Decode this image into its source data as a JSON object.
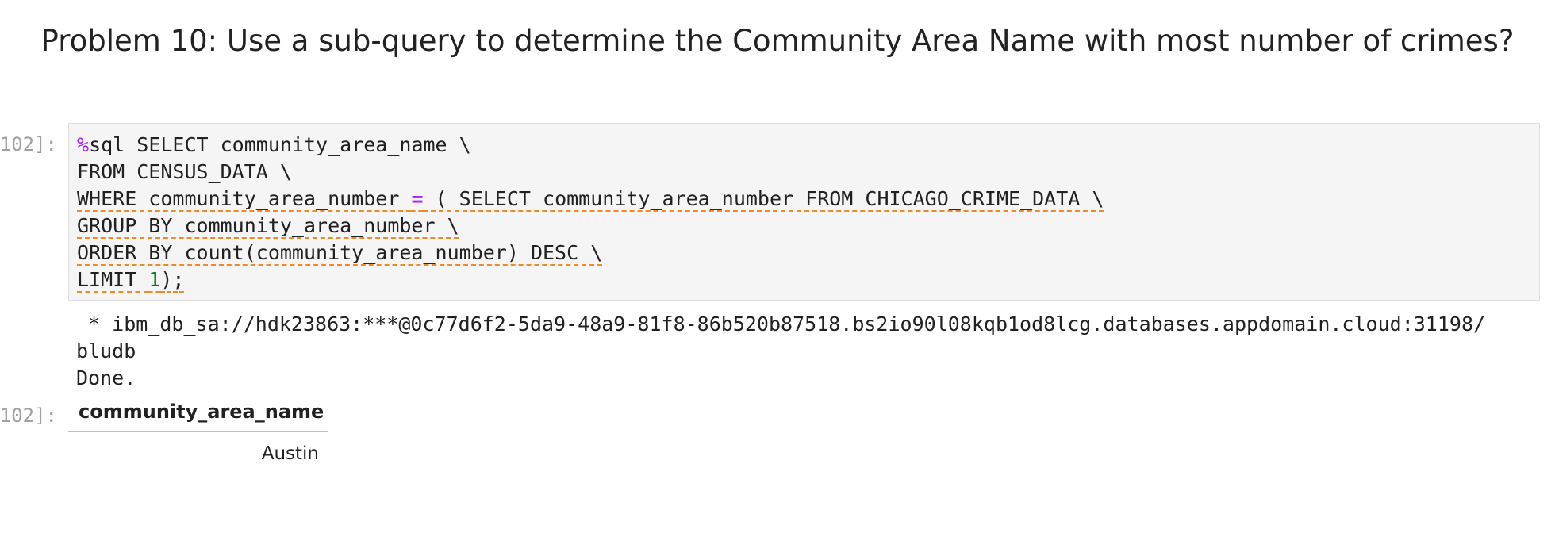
{
  "heading": "Problem 10: Use a sub-query to determine the Community Area Name with most number of crimes?",
  "input_prompt": "102]:",
  "output_prompt": "102]:",
  "code": {
    "magic": "%",
    "line1_rest": "sql SELECT community_area_name \\",
    "line2": "FROM CENSUS_DATA \\",
    "line3_a": "WHERE community_area_number ",
    "line3_op": "=",
    "line3_b": " ( SELECT community_area_number FROM CHICAGO_CRIME_DATA \\",
    "line4": "GROUP BY community_area_number \\",
    "line5": "ORDER BY count(community_area_number) DESC \\",
    "line6_a": "LIMIT ",
    "line6_num": "1",
    "line6_b": ");"
  },
  "output": {
    "line1": " * ibm_db_sa://hdk23863:***@0c77d6f2-5da9-48a9-81f8-86b520b87518.bs2io90l08kqb1od8lcg.databases.appdomain.cloud:31198/",
    "line2": "bludb",
    "line3": "Done."
  },
  "result_table": {
    "columns": [
      "community_area_name"
    ],
    "rows": [
      [
        "Austin"
      ]
    ]
  }
}
